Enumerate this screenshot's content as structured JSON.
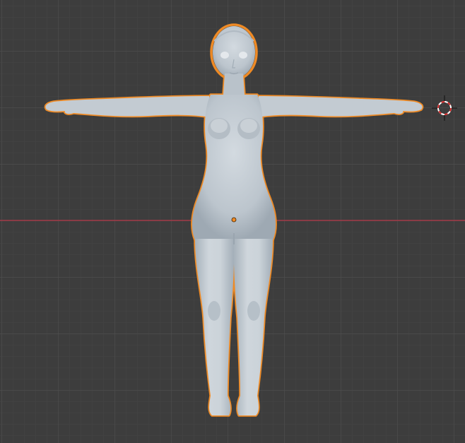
{
  "viewport": {
    "view": "front-orthographic",
    "background_color": "#3d3d3d",
    "grid_minor_color": "#444444",
    "grid_major_color": "#4f4f4f",
    "x_axis_color": "#a33b48",
    "selection_outline_color": "#ee8a25",
    "mesh_color": "#c4ccd3"
  },
  "scene": {
    "selected_object": {
      "kind": "humanoid-mesh",
      "pose": "T-pose",
      "selected": true,
      "origin_marker": "origin-dot-icon"
    },
    "cursor_3d": {
      "icon": "3d-cursor-icon",
      "colors": [
        "#ffffff",
        "#d42a2a"
      ]
    }
  }
}
